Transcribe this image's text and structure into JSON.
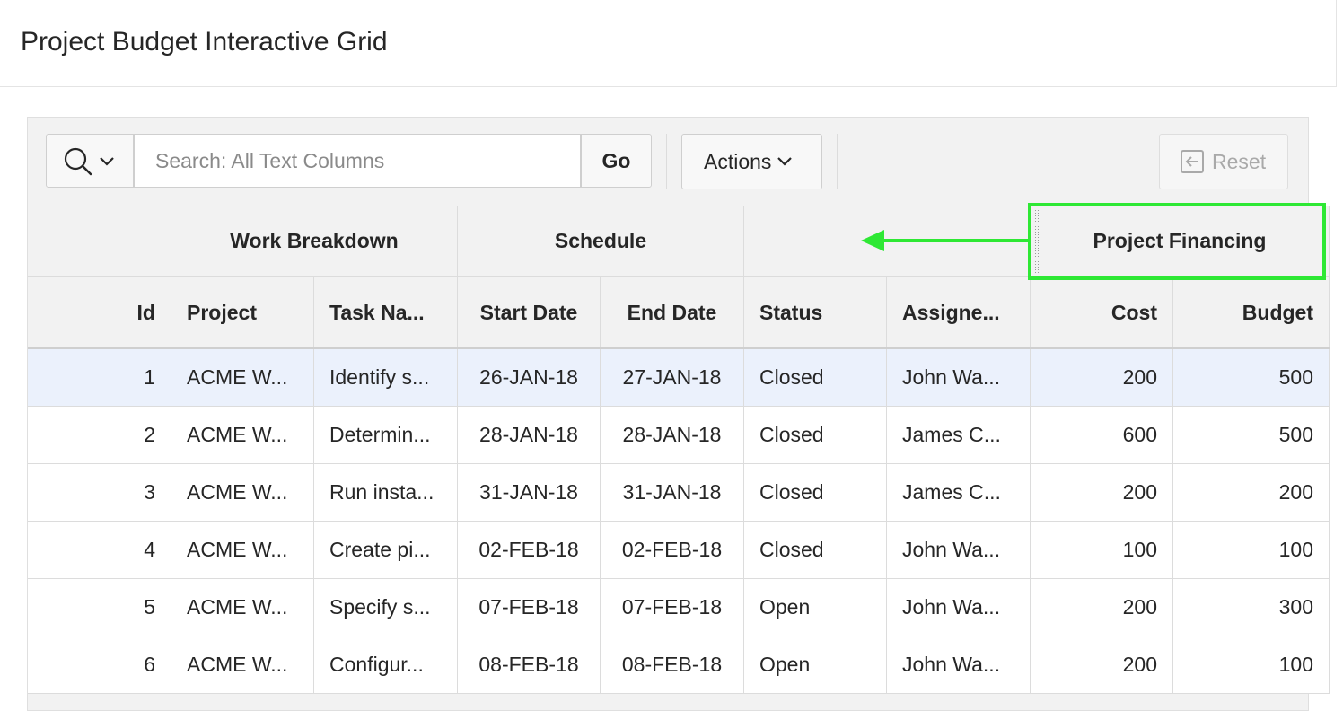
{
  "page": {
    "title": "Project Budget Interactive Grid"
  },
  "toolbar": {
    "search_icon": "search-icon",
    "search_placeholder": "Search: All Text Columns",
    "search_value": "",
    "go_label": "Go",
    "actions_label": "Actions",
    "reset_label": "Reset",
    "reset_enabled": false
  },
  "column_groups": [
    {
      "label": ""
    },
    {
      "label": "Work Breakdown"
    },
    {
      "label": "Schedule"
    },
    {
      "label": ""
    },
    {
      "label": "Project Financing"
    }
  ],
  "columns": [
    {
      "label": "Id"
    },
    {
      "label": "Project"
    },
    {
      "label": "Task Na..."
    },
    {
      "label": "Start Date"
    },
    {
      "label": "End Date"
    },
    {
      "label": "Status"
    },
    {
      "label": "Assigne..."
    },
    {
      "label": "Cost"
    },
    {
      "label": "Budget"
    }
  ],
  "rows": [
    [
      "1",
      "ACME W...",
      "Identify s...",
      "26-JAN-18",
      "27-JAN-18",
      "Closed",
      "John Wa...",
      "200",
      "500"
    ],
    [
      "2",
      "ACME W...",
      "Determin...",
      "28-JAN-18",
      "28-JAN-18",
      "Closed",
      "James C...",
      "600",
      "500"
    ],
    [
      "3",
      "ACME W...",
      "Run insta...",
      "31-JAN-18",
      "31-JAN-18",
      "Closed",
      "James C...",
      "200",
      "200"
    ],
    [
      "4",
      "ACME W...",
      "Create pi...",
      "02-FEB-18",
      "02-FEB-18",
      "Closed",
      "John Wa...",
      "100",
      "100"
    ],
    [
      "5",
      "ACME W...",
      "Specify s...",
      "07-FEB-18",
      "07-FEB-18",
      "Open",
      "John Wa...",
      "200",
      "300"
    ],
    [
      "6",
      "ACME W...",
      "Configur...",
      "08-FEB-18",
      "08-FEB-18",
      "Open",
      "John Wa...",
      "200",
      "100"
    ]
  ],
  "selected_row": 0,
  "colors": {
    "callout": "#2ee834",
    "selected_row_bg": "#ebf1fc",
    "header_bg": "#f2f2f2"
  }
}
